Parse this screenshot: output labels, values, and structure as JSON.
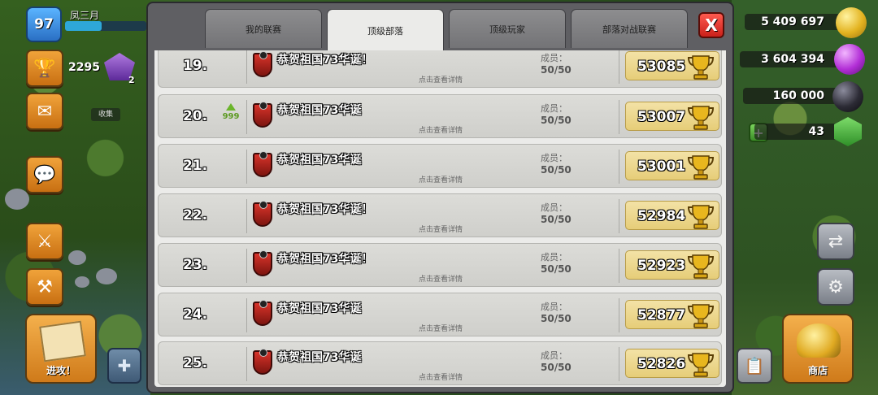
{
  "hud": {
    "level": "97",
    "player_name": "凤三月",
    "xp_percent": 45,
    "trophies": "2295",
    "league_tier": "2",
    "collect_label": "收集",
    "attack_label": "进攻！",
    "shop_label": "商店"
  },
  "resources": {
    "gold": "5 409 697",
    "elixir": "3 604 394",
    "dark_elixir": "160 000",
    "gems": "43"
  },
  "tabs": [
    {
      "label": "我的联赛",
      "active": false
    },
    {
      "label": "顶级部落",
      "active": true
    },
    {
      "label": "顶级玩家",
      "active": false
    },
    {
      "label": "部落对战联赛",
      "active": false
    }
  ],
  "close_label": "X",
  "members_label": "成员：",
  "details_label": "点击查看详情",
  "rows": [
    {
      "rank": "19.",
      "name": "恭贺祖国73华诞！",
      "members": "50/50",
      "score": "53085",
      "trend": ""
    },
    {
      "rank": "20.",
      "name": "恭贺祖国73华诞",
      "members": "50/50",
      "score": "53007",
      "trend": "999"
    },
    {
      "rank": "21.",
      "name": "恭贺祖国73华诞",
      "members": "50/50",
      "score": "53001",
      "trend": ""
    },
    {
      "rank": "22.",
      "name": "恭贺祖国73华诞！",
      "members": "50/50",
      "score": "52984",
      "trend": ""
    },
    {
      "rank": "23.",
      "name": "恭贺祖国73华诞！",
      "members": "50/50",
      "score": "52923",
      "trend": ""
    },
    {
      "rank": "24.",
      "name": "恭贺祖国73华诞",
      "members": "50/50",
      "score": "52877",
      "trend": ""
    },
    {
      "rank": "25.",
      "name": "恭贺祖国73华诞",
      "members": "50/50",
      "score": "52826",
      "trend": ""
    }
  ]
}
